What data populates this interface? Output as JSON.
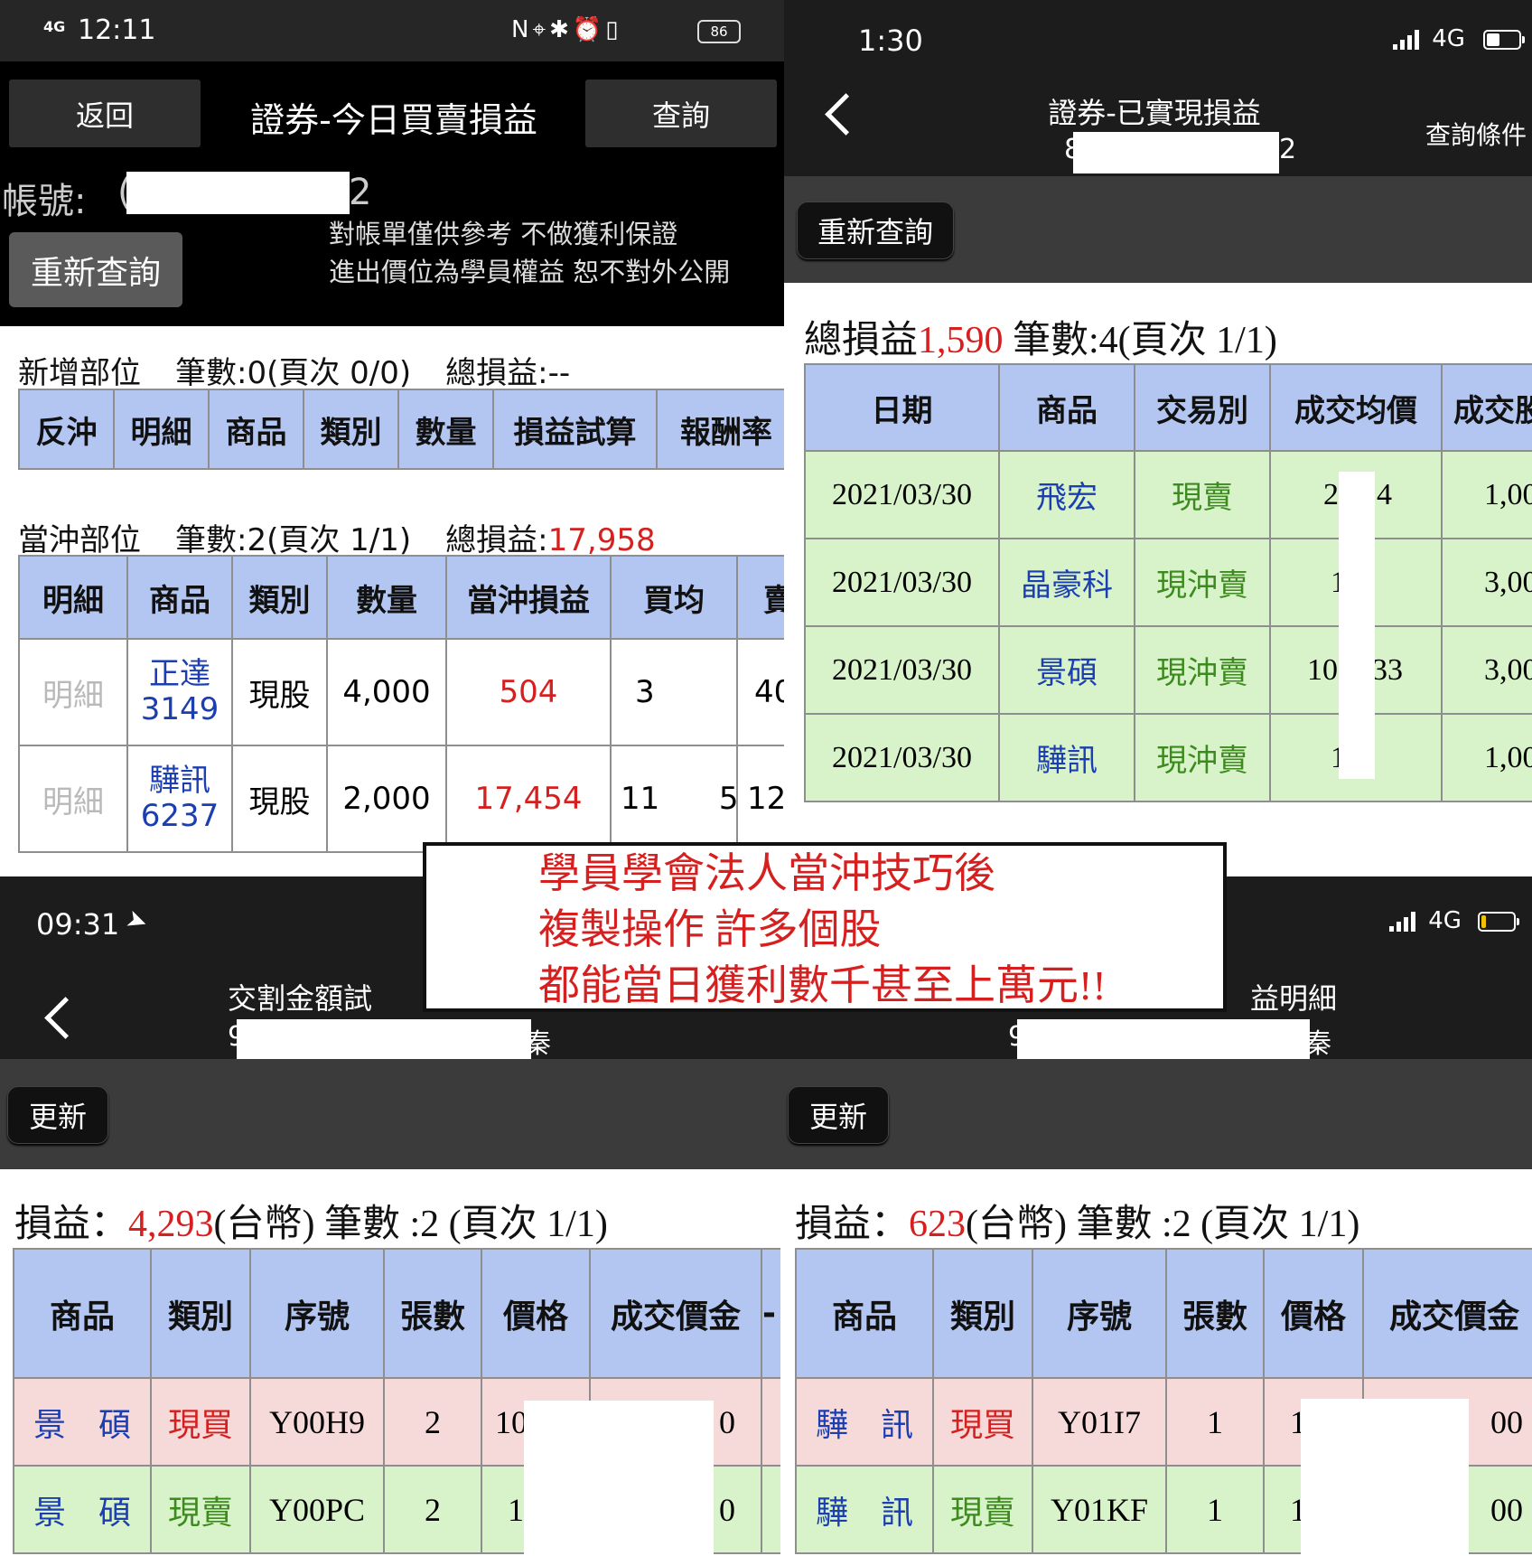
{
  "p1": {
    "status": {
      "signal": "4G",
      "time": "12:11",
      "battery": "86"
    },
    "back": "返回",
    "title": "證券-今日買賣損益",
    "query": "查詢",
    "account_label": "帳號:",
    "account_prefix": "(",
    "account_suffix": "2",
    "refresh": "重新查詢",
    "disclaimer1": "對帳單僅供參考 不做獲利保證",
    "disclaimer2": "進出價位為學員權益 恕不對外公開",
    "new_pos": {
      "label": "新增部位",
      "count": "筆數:0(頁次 0/0)",
      "total_label": "總損益:",
      "total": "--"
    },
    "new_headers": [
      "反沖",
      "明細",
      "商品",
      "類別",
      "數量",
      "損益試算",
      "報酬率"
    ],
    "day_pos": {
      "label": "當沖部位",
      "count": "筆數:2(頁次 1/1)",
      "total_label": "總損益:",
      "total": "17,958"
    },
    "day_headers": [
      "明細",
      "商品",
      "類別",
      "數量",
      "當沖損益",
      "買均",
      "賣"
    ],
    "rows": [
      {
        "detail": "明細",
        "name": "正達",
        "code": "3149",
        "type": "現股",
        "qty": "4,000",
        "pnl": "504",
        "buy": "3",
        "sell": "40"
      },
      {
        "detail": "明細",
        "name": "驊訊",
        "code": "6237",
        "type": "現股",
        "qty": "2,000",
        "pnl": "17,454",
        "buy": "114",
        "buy2": "5",
        "sell": "12"
      }
    ]
  },
  "p2": {
    "status": {
      "time": "1:30",
      "net": "4G"
    },
    "title": "證券-已實現損益",
    "acct_first": "8",
    "acct_last": "2",
    "query_cond": "查詢條件",
    "refresh": "重新查詢",
    "summary_label": "總損益",
    "summary_value": "1,590",
    "summary_rest": " 筆數:4(頁次 1/1)",
    "headers": [
      "日期",
      "商品",
      "交易別",
      "成交均價",
      "成交股"
    ],
    "rows": [
      {
        "date": "2021/03/30",
        "name": "飛宏",
        "type": "現賣",
        "price_a": "2",
        "price_b": "4",
        "qty": "1,00"
      },
      {
        "date": "2021/03/30",
        "name": "晶豪科",
        "type": "現沖賣",
        "price_a": "1",
        "price_b": "",
        "qty": "3,00"
      },
      {
        "date": "2021/03/30",
        "name": "景碩",
        "type": "現沖賣",
        "price_a": "10",
        "price_b": "33",
        "qty": "3,00"
      },
      {
        "date": "2021/03/30",
        "name": "驊訊",
        "type": "現沖賣",
        "price_a": "1",
        "price_b": "",
        "qty": "1,00"
      }
    ]
  },
  "p3": {
    "status": {
      "time": "09:31"
    },
    "title": "交割金額試",
    "sub_first": "9",
    "sub_last": "秦",
    "refresh": "更新",
    "summary_label": "損益：",
    "summary_value": "4,293",
    "summary_rest": "(台幣) 筆數 :2 (頁次 1/1)",
    "headers": [
      "商品",
      "類別",
      "序號",
      "張數",
      "價格",
      "成交價金",
      "-"
    ],
    "rows": [
      {
        "name": "景　碩",
        "type": "現買",
        "serial": "Y00H9",
        "lots": "2",
        "price": "10",
        "amount": "0"
      },
      {
        "name": "景　碩",
        "type": "現賣",
        "serial": "Y00PC",
        "lots": "2",
        "price": "1",
        "amount": "0"
      }
    ]
  },
  "p4": {
    "status": {
      "net": "4G"
    },
    "title": "益明細",
    "sub_first": "9",
    "sub_last": "秦",
    "refresh": "更新",
    "summary_label": "損益：",
    "summary_value": "623",
    "summary_rest": "(台幣) 筆數 :2 (頁次 1/1)",
    "headers": [
      "商品",
      "類別",
      "序號",
      "張數",
      "價格",
      "成交價金"
    ],
    "rows": [
      {
        "name": "驊　訊",
        "type": "現買",
        "serial": "Y01I7",
        "lots": "1",
        "price": "1",
        "amount": "00"
      },
      {
        "name": "驊　訊",
        "type": "現賣",
        "serial": "Y01KF",
        "lots": "1",
        "price": "1",
        "amount": "00"
      }
    ]
  },
  "overlay": {
    "line1": "學員學會法人當沖技巧後",
    "line2": "複製操作 許多個股",
    "line3": "都能當日獲利數千甚至上萬元!!"
  },
  "colors": {
    "header_blue": "#b3c6f2",
    "profit_red": "#d62020",
    "name_blue": "#1b3fb0",
    "sell_green": "#3d8a1e",
    "row_green": "#d8f2c9",
    "row_pink": "#f6d9d9"
  }
}
